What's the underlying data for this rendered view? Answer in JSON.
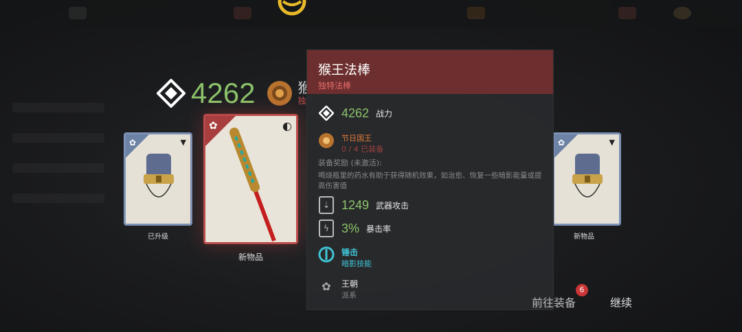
{
  "header": {
    "power": "4262",
    "title_fragment": "猴",
    "subtitle_fragment": "独特"
  },
  "cards": {
    "left_label": "已升级",
    "center_label": "新物品",
    "right_label": "新物品"
  },
  "tooltip": {
    "name": "猴王法棒",
    "kind": "独特法棒",
    "power_value": "4262",
    "power_label": "战力",
    "set_name": "节日国王",
    "set_progress": "0 / 4 已装备",
    "bonus_title": "装备奖励 (未激活):",
    "bonus_text": "喝烧瓶里的药水有助于获得随机效果，如治愈、恢复一些暗影能量或提高伤害值",
    "stats": [
      {
        "value": "1249",
        "label": "武器攻击"
      },
      {
        "value": "3%",
        "label": "暴击率"
      }
    ],
    "skill_name": "锤击",
    "skill_type": "暗影技能",
    "faction_name": "王朝",
    "faction_type": "派系"
  },
  "footer": {
    "equip_label": "前往装备",
    "equip_badge": "6",
    "continue_label": "继续"
  },
  "colors": {
    "accent_red": "#6c2e2e",
    "power_green": "#8cc36b",
    "skill_teal": "#3fc5d6",
    "card_blue": "#7d93b5"
  }
}
